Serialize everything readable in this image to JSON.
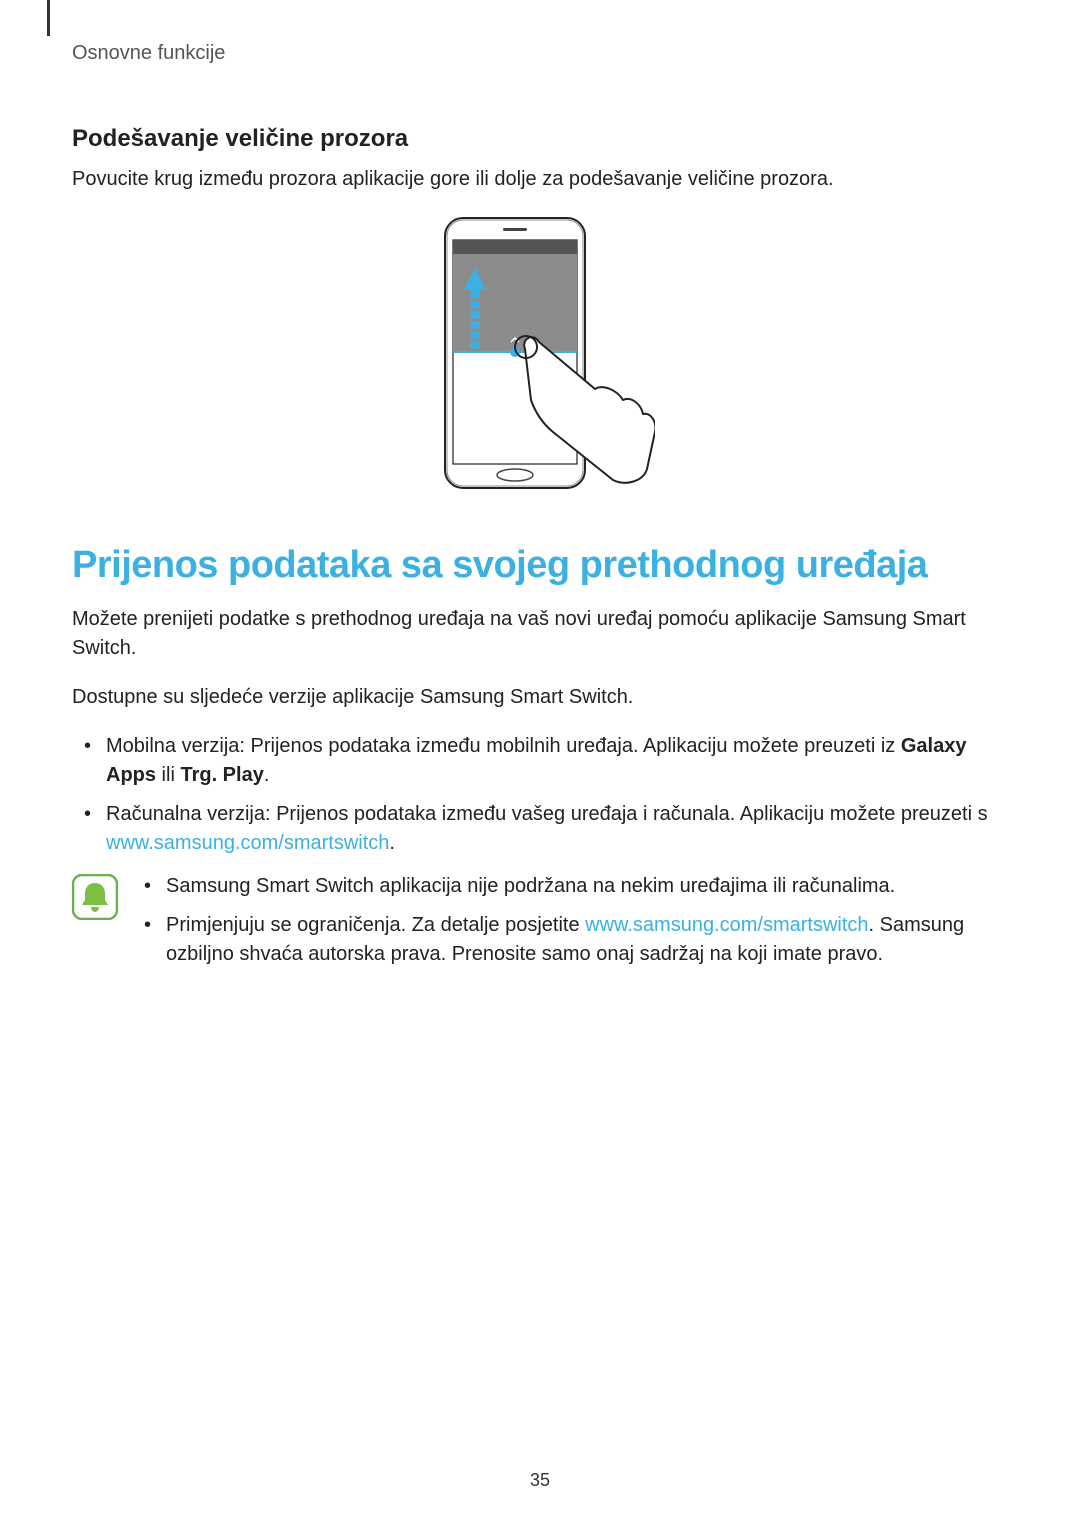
{
  "chapter": "Osnovne funkcije",
  "section1": {
    "heading": "Podešavanje veličine prozora",
    "body": "Povucite krug između prozora aplikacije gore ili dolje za podešavanje veličine prozora."
  },
  "section2": {
    "heading": "Prijenos podataka sa svojeg prethodnog uređaja",
    "p1": "Možete prenijeti podatke s prethodnog uređaja na vaš novi uređaj pomoću aplikacije Samsung Smart Switch.",
    "p2": "Dostupne su sljedeće verzije aplikacije Samsung Smart Switch.",
    "bullets": [
      {
        "prefix": "Mobilna verzija: Prijenos podataka između mobilnih uređaja. Aplikaciju možete preuzeti iz ",
        "bold1": "Galaxy Apps",
        "mid": " ili ",
        "bold2": "Trg. Play",
        "suffix": "."
      },
      {
        "prefix": "Računalna verzija: Prijenos podataka između vašeg uređaja i računala. Aplikaciju možete preuzeti s ",
        "link": "www.samsung.com/smartswitch",
        "suffix": "."
      }
    ],
    "notes": [
      {
        "text": "Samsung Smart Switch aplikacija nije podržana na nekim uređajima ili računalima."
      },
      {
        "prefix": "Primjenjuju se ograničenja. Za detalje posjetite ",
        "link": "www.samsung.com/smartswitch",
        "suffix": ". Samsung ozbiljno shvaća autorska prava. Prenosite samo onaj sadržaj na koji imate pravo."
      }
    ]
  },
  "pageNumber": "35"
}
